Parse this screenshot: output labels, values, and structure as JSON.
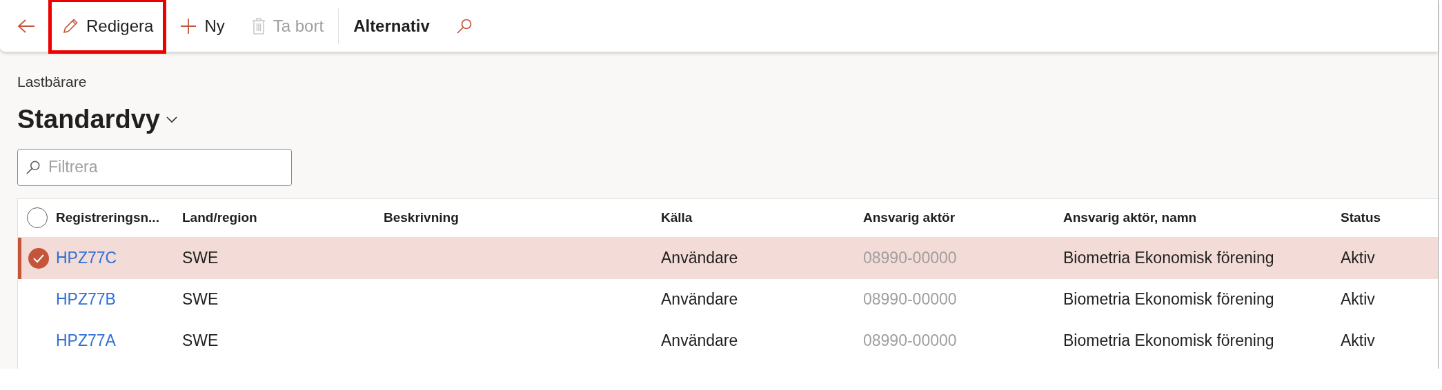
{
  "toolbar": {
    "buttons": [
      {
        "kind": "back",
        "disabled": false,
        "highlighted": false
      },
      {
        "kind": "edit",
        "label": "Redigera",
        "disabled": false,
        "highlighted": true
      },
      {
        "kind": "new",
        "label": "Ny",
        "disabled": false,
        "highlighted": false
      },
      {
        "kind": "delete",
        "label": "Ta bort",
        "disabled": true,
        "highlighted": false
      },
      {
        "kind": "menu",
        "label": "Alternativ",
        "disabled": false,
        "highlighted": false
      },
      {
        "kind": "search",
        "disabled": false,
        "highlighted": false
      }
    ]
  },
  "page": {
    "caption": "Lastbärare",
    "view": "Standardvy"
  },
  "filter": {
    "placeholder": "Filtrera"
  },
  "table": {
    "select_all": {
      "checked": false
    },
    "columns": [
      "Registreringsn...",
      "Land/region",
      "Beskrivning",
      "Källa",
      "Ansvarig aktör",
      "Ansvarig aktör, namn",
      "Status"
    ],
    "rows": [
      {
        "selected": true,
        "cells": [
          "HPZ77C",
          "SWE",
          "",
          "Användare",
          "08990-00000",
          "Biometria Ekonomisk förening",
          "Aktiv"
        ]
      },
      {
        "selected": false,
        "cells": [
          "HPZ77B",
          "SWE",
          "",
          "Användare",
          "08990-00000",
          "Biometria Ekonomisk förening",
          "Aktiv"
        ]
      },
      {
        "selected": false,
        "cells": [
          "HPZ77A",
          "SWE",
          "",
          "Användare",
          "08990-00000",
          "Biometria Ekonomisk förening",
          "Aktiv"
        ]
      }
    ]
  }
}
